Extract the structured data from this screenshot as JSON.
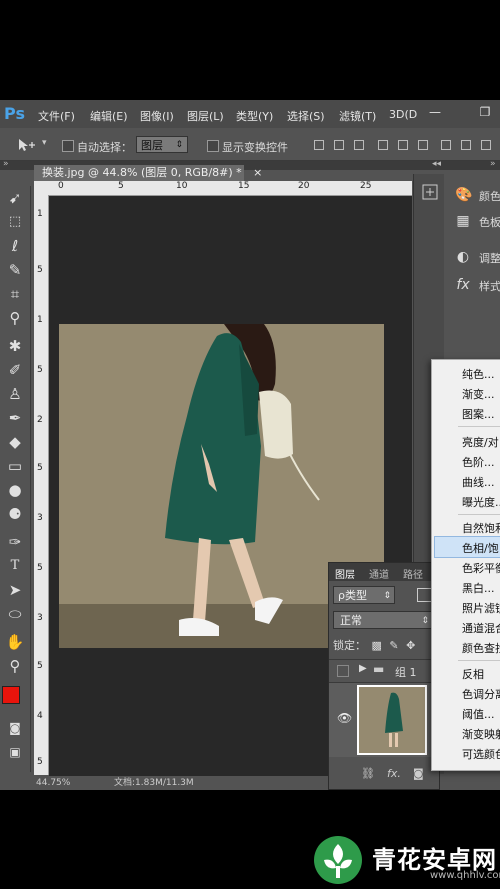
{
  "app": {
    "logo": "Ps"
  },
  "menubar": {
    "items": [
      "文件(F)",
      "编辑(E)",
      "图像(I)",
      "图层(L)",
      "类型(Y)",
      "选择(S)",
      "滤镜(T)",
      "3D(D"
    ]
  },
  "window_controls": {
    "minimize": "—",
    "restore": "❐"
  },
  "options_bar": {
    "auto_select_label": "自动选择：",
    "auto_select_target": "图层",
    "show_transform_label": "显示变换控件"
  },
  "document": {
    "tab_title": "换装.jpg @ 44.8% (图层 0, RGB/8#) *",
    "tab_close": "×",
    "ruler_h_numbers": [
      "0",
      "5",
      "10",
      "15",
      "20",
      "25"
    ],
    "ruler_v_numbers": [
      "1",
      "5",
      "1",
      "5",
      "2",
      "5",
      "3",
      "5",
      "3",
      "5",
      "4",
      "5"
    ],
    "status_zoom": "44.75%",
    "status_doc": "文档:1.83M/11.3M"
  },
  "right_panels": {
    "items": [
      {
        "icon": "palette-icon",
        "label": "颜色"
      },
      {
        "icon": "swatches-icon",
        "label": "色板"
      },
      {
        "icon": "adjustments-icon",
        "label": "调整"
      },
      {
        "icon": "styles-icon",
        "label": "样式"
      }
    ]
  },
  "layers_panel": {
    "tabs": [
      "图层",
      "通道",
      "路径"
    ],
    "kind_filter": "ρ类型",
    "blend_mode": "正常",
    "lock_label": "锁定：",
    "group_name": "组 1",
    "footer_icons": [
      "link-icon",
      "fx-icon",
      "mask-icon"
    ],
    "footer_fx": "fx."
  },
  "adjustment_menu": {
    "group1": [
      "纯色...",
      "渐变...",
      "图案..."
    ],
    "group2": [
      "亮度/对",
      "色阶...",
      "曲线...",
      "曝光度..."
    ],
    "group3": [
      "自然饱和",
      "色相/饱",
      "色彩平衡",
      "黑白...",
      "照片滤镜",
      "通道混合",
      "颜色查找"
    ],
    "group4": [
      "反相",
      "色调分离",
      "阈值...",
      "渐变映射",
      "可选颜色"
    ],
    "highlighted": "色相/饱"
  },
  "watermark": {
    "title": "青花安卓网",
    "url": "www.qhhlv.com"
  },
  "colors": {
    "foreground": "#e8140c",
    "background": "#ffffff",
    "accent": "#4aa3e8"
  }
}
